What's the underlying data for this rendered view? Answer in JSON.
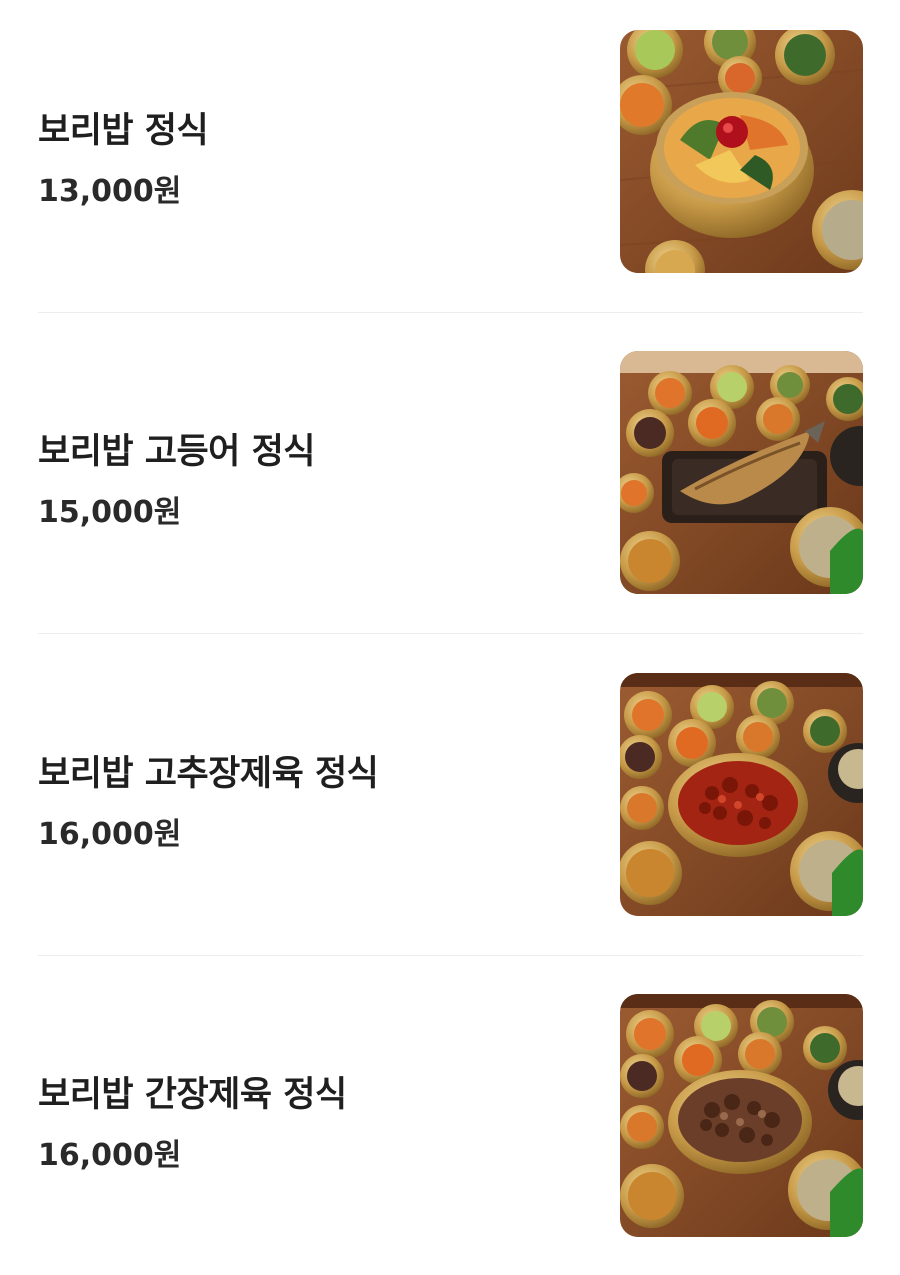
{
  "menu": {
    "items": [
      {
        "name": "보리밥 정식",
        "price": "13,000원",
        "image": "bibimbap-set-photo"
      },
      {
        "name": "보리밥 고등어 정식",
        "price": "15,000원",
        "image": "grilled-mackerel-set-photo"
      },
      {
        "name": "보리밥 고추장제육 정식",
        "price": "16,000원",
        "image": "spicy-pork-set-photo"
      },
      {
        "name": "보리밥 간장제육 정식",
        "price": "16,000원",
        "image": "soy-pork-set-photo"
      }
    ]
  },
  "colors": {
    "text": "#1f1f1f",
    "divider": "#ededed",
    "wood": "#8a4a25",
    "brass": "#c89b4a"
  }
}
